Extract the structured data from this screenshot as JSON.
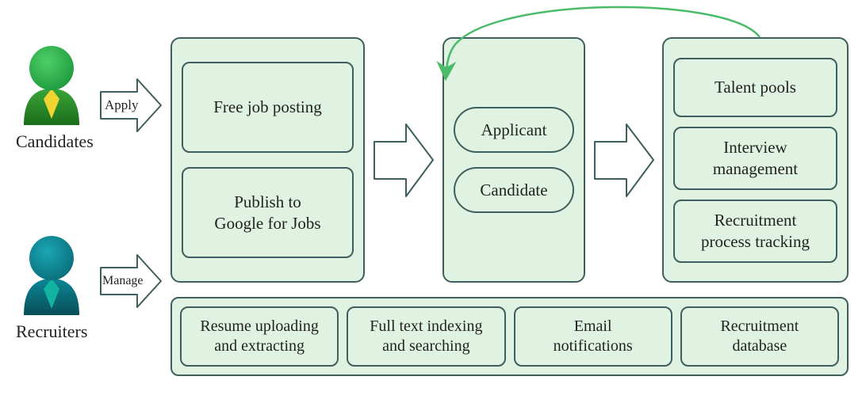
{
  "actors": {
    "candidates": {
      "label": "Candidates"
    },
    "recruiters": {
      "label": "Recruiters"
    }
  },
  "arrows": {
    "apply": {
      "label": "Apply"
    },
    "manage": {
      "label": "Manage"
    }
  },
  "posting_box": {
    "item1": "Free job posting",
    "item2": "Publish to\nGoogle for Jobs"
  },
  "middle_box": {
    "pill1": "Applicant",
    "pill2": "Candidate"
  },
  "right_box": {
    "item1": "Talent pools",
    "item2": "Interview\nmanagement",
    "item3": "Recruitment\nprocess tracking"
  },
  "bottom_bar": {
    "b1": "Resume uploading\nand extracting",
    "b2": "Full text indexing\nand searching",
    "b3": "Email\nnotifications",
    "b4": "Recruitment\ndatabase"
  },
  "colors": {
    "candidate_head": "#2fb74e",
    "candidate_body_top": "#3aa53a",
    "candidate_body_bot": "#237a22",
    "candidate_tie": "#f0d532",
    "recruiter_head": "#0f8a98",
    "recruiter_body_top": "#0a7d8c",
    "recruiter_body_bot": "#0a5c68",
    "recruiter_tie": "#13b3a2",
    "feedback_arrow": "#4bbb6a"
  }
}
